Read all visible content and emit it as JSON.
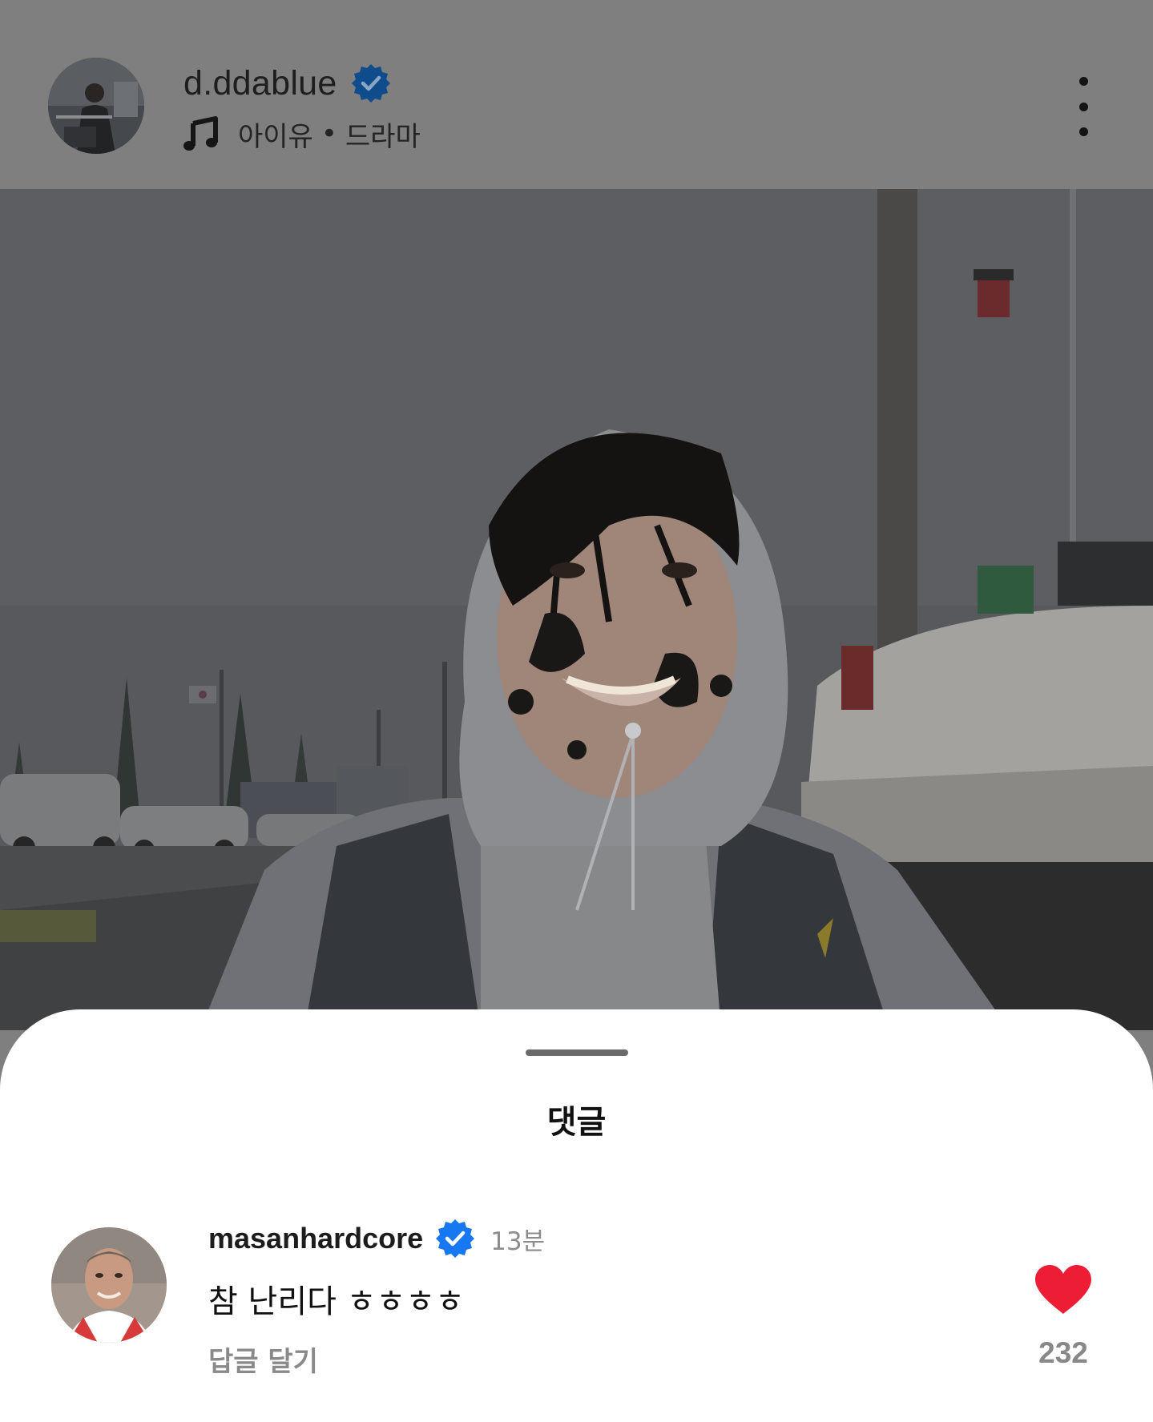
{
  "post": {
    "username": "d.ddablue",
    "music": {
      "artist": "아이유",
      "separator": "•",
      "title": "드라마"
    }
  },
  "icons": {
    "verified": "verified-badge-icon",
    "music": "music-note-icon",
    "more": "more-vertical-icon",
    "like": "heart-icon"
  },
  "colors": {
    "verified_blue": "#1877f2",
    "like_red": "#ee1d36",
    "overlay_gray": "#7f7f7f"
  },
  "comments_sheet": {
    "title": "댓글",
    "comments": [
      {
        "username": "masanhardcore",
        "time": "13분",
        "text": "참 난리다 ㅎㅎㅎㅎ",
        "reply_label": "답글 달기",
        "like_count": "232",
        "liked": true
      }
    ]
  }
}
